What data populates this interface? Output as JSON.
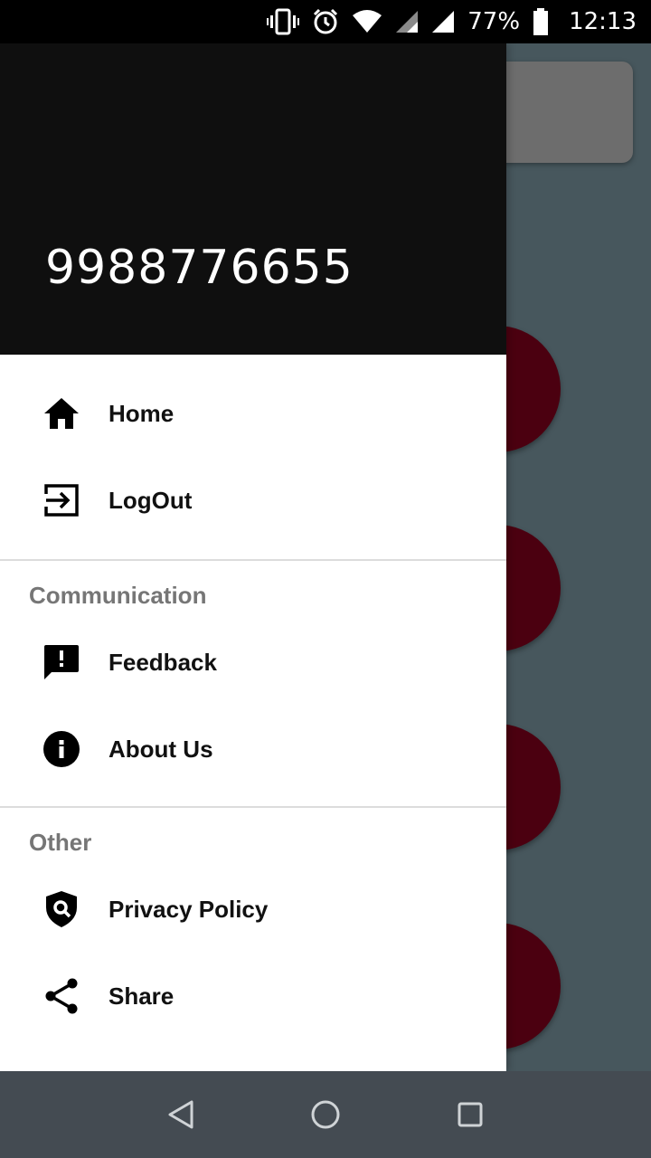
{
  "status_bar": {
    "battery_percent": "77%",
    "time": "12:13",
    "icons": [
      "vibrate-icon",
      "alarm-icon",
      "wifi-icon",
      "signal-icon",
      "signal-icon",
      "battery-icon"
    ]
  },
  "drawer": {
    "header": {
      "phone": "9988776655"
    },
    "primary_items": [
      {
        "label": "Home",
        "icon": "home-icon"
      },
      {
        "label": "LogOut",
        "icon": "logout-icon"
      }
    ],
    "sections": [
      {
        "title": "Communication",
        "items": [
          {
            "label": "Feedback",
            "icon": "feedback-icon"
          },
          {
            "label": "About Us",
            "icon": "info-icon"
          }
        ]
      },
      {
        "title": "Other",
        "items": [
          {
            "label": "Privacy Policy",
            "icon": "privacy-shield-icon"
          },
          {
            "label": "Share",
            "icon": "share-icon"
          }
        ]
      }
    ]
  },
  "colors": {
    "drawer_header_bg": "#0f0f0f",
    "scrim_bg": "#47575d",
    "circle_accent": "#4b0010",
    "section_title": "#767676",
    "nav_bar_bg": "#444b52"
  }
}
